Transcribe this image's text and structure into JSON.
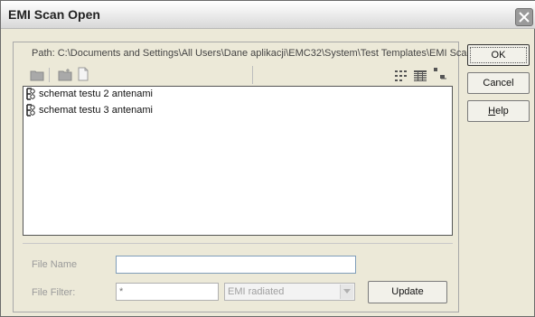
{
  "window": {
    "title": "EMI Scan Open"
  },
  "path_label": "Path: C:\\Documents and Settings\\All Users\\Dane aplikacji\\EMC32\\System\\Test Templates\\EMI Scan",
  "toolbar": {
    "icons": [
      "folder-up-icon",
      "new-folder-icon",
      "new-file-icon",
      "list-view-icon",
      "details-view-icon",
      "small-icons-view-icon"
    ]
  },
  "file_list": {
    "items": [
      {
        "label": "schemat testu 2 antenami",
        "icon": "template-icon"
      },
      {
        "label": "schemat testu 3 antenami",
        "icon": "template-icon"
      }
    ]
  },
  "form": {
    "file_name": {
      "label": "File Name",
      "value": ""
    },
    "file_filter": {
      "label": "File Filter:",
      "value": "*"
    },
    "filter_type": {
      "selected": "EMI radiated"
    },
    "update_label": "Update"
  },
  "buttons": {
    "ok": "OK",
    "cancel": "Cancel",
    "help_underline": "H",
    "help_rest": "elp"
  }
}
